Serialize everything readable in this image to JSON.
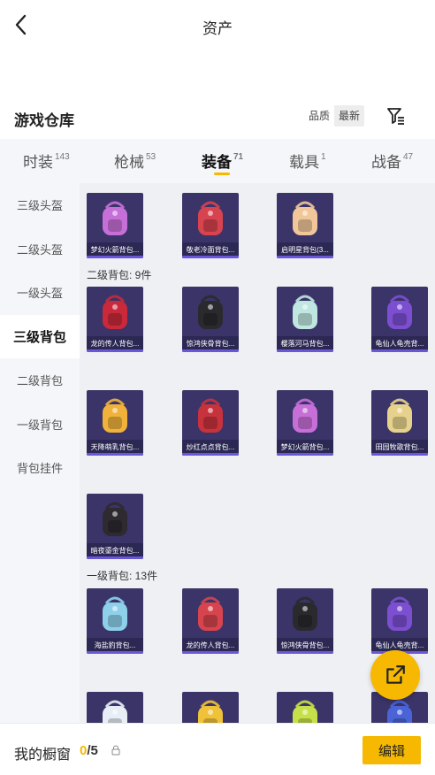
{
  "header": {
    "title": "资产"
  },
  "store": {
    "title": "游戏仓库",
    "sort_options": [
      "品质",
      "最新"
    ],
    "sort_selected": "最新"
  },
  "tabs": [
    {
      "label": "时装",
      "count": "143"
    },
    {
      "label": "枪械",
      "count": "53"
    },
    {
      "label": "装备",
      "count": "71",
      "active": true
    },
    {
      "label": "载具",
      "count": "1"
    },
    {
      "label": "战备",
      "count": "47"
    }
  ],
  "sidebar": {
    "items": [
      "三级头盔",
      "二级头盔",
      "一级头盔",
      "三级背包",
      "二级背包",
      "一级背包",
      "背包挂件"
    ],
    "active_index": 3
  },
  "sections": [
    {
      "label": "",
      "items": [
        {
          "name": "梦幻火箭背包...",
          "icon": "backpack-pink-icon",
          "color": "#c76fd8"
        },
        {
          "name": "敬老冷面背包...",
          "icon": "backpack-red-icon",
          "color": "#d7434f"
        },
        {
          "name": "启明星背包(3...",
          "icon": "backpack-white-icon",
          "color": "#f1c79a"
        }
      ]
    },
    {
      "label": "二级背包: 9件",
      "items": [
        {
          "name": "龙的传人背包...",
          "icon": "backpack-red-icon",
          "color": "#c9293a"
        },
        {
          "name": "惊鸿侠骨背包...",
          "icon": "backpack-black-icon",
          "color": "#2a2a2e"
        },
        {
          "name": "樱落河马背包...",
          "icon": "backpack-mint-icon",
          "color": "#bfe6e0"
        },
        {
          "name": "龟仙人龟壳背...",
          "icon": "backpack-purple-icon",
          "color": "#7c4fd1"
        },
        {
          "name": "天降萌乳背包...",
          "icon": "backpack-yellow-icon",
          "color": "#f0b23a"
        },
        {
          "name": "炒红点点背包...",
          "icon": "backpack-red-icon",
          "color": "#c8323c"
        },
        {
          "name": "梦幻火箭背包...",
          "icon": "backpack-pink-icon",
          "color": "#c76fd8"
        },
        {
          "name": "田园牧歌背包...",
          "icon": "backpack-basket-icon",
          "color": "#e7d28d"
        },
        {
          "name": "暗夜鎏金背包...",
          "icon": "backpack-black-icon",
          "color": "#2e2a30"
        }
      ]
    },
    {
      "label": "一级背包: 13件",
      "items": [
        {
          "name": "海盐豹背包...",
          "icon": "backpack-blue-icon",
          "color": "#8ed0ea"
        },
        {
          "name": "龙的传人背包...",
          "icon": "backpack-red-icon",
          "color": "#d7444e"
        },
        {
          "name": "惊鸿侠骨背包...",
          "icon": "backpack-black-icon",
          "color": "#2a2a2e"
        },
        {
          "name": "龟仙人龟壳背...",
          "icon": "backpack-purple-icon",
          "color": "#7c4fd1"
        },
        {
          "name": "",
          "icon": "backpack-white-icon",
          "color": "#e8eef6"
        },
        {
          "name": "",
          "icon": "backpack-yellow-icon",
          "color": "#f0c23a"
        },
        {
          "name": "",
          "icon": "backpack-lime-icon",
          "color": "#c6e04a"
        },
        {
          "name": "",
          "icon": "backpack-blue-icon",
          "color": "#4a64d8"
        }
      ]
    }
  ],
  "footer": {
    "wardrobe_label": "我的橱窗",
    "count_current": "0",
    "count_total": "/5",
    "edit_label": "编辑"
  },
  "colors": {
    "accent": "#f6b800",
    "card_bg": "#3a3468",
    "sidebar_bg": "#f4f6f9"
  }
}
